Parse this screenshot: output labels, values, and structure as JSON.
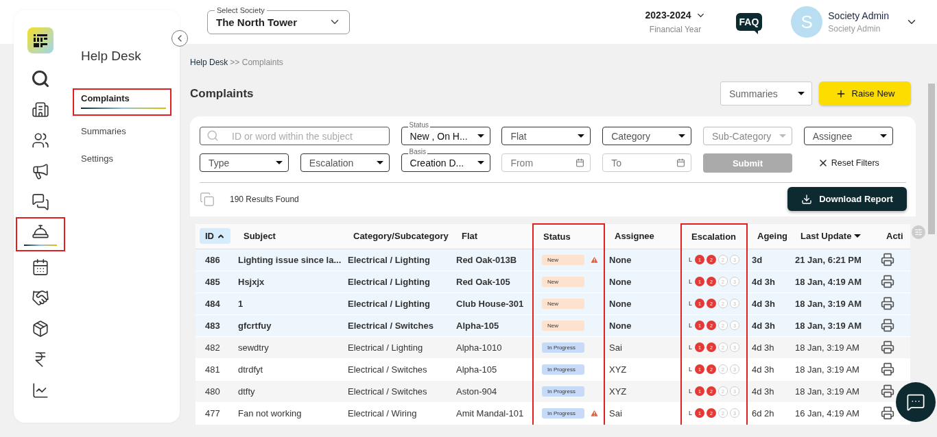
{
  "header": {
    "society": {
      "label": "Select Society",
      "value": "The North Tower"
    },
    "year": {
      "value": "2023-2024",
      "caption": "Financial Year"
    },
    "faq": "FAQ",
    "user": {
      "initial": "S",
      "name": "Society Admin",
      "role": "Society Admin"
    }
  },
  "rail": [
    {
      "selected": false,
      "highlighted": false
    },
    {
      "selected": false,
      "highlighted": false
    },
    {
      "selected": false,
      "highlighted": false
    },
    {
      "selected": false,
      "highlighted": false
    },
    {
      "selected": false,
      "highlighted": false
    },
    {
      "selected": true,
      "highlighted": true
    },
    {
      "selected": false,
      "highlighted": false
    },
    {
      "selected": false,
      "highlighted": false
    },
    {
      "selected": false,
      "highlighted": false
    },
    {
      "selected": false,
      "highlighted": false
    },
    {
      "selected": false,
      "highlighted": false
    }
  ],
  "submenu": {
    "title": "Help Desk",
    "items": [
      {
        "label": "Complaints",
        "selected": true,
        "highlighted": true
      },
      {
        "label": "Summaries",
        "selected": false,
        "highlighted": false
      },
      {
        "label": "Settings",
        "selected": false,
        "highlighted": false
      }
    ]
  },
  "breadcrumb": [
    "Help Desk",
    ">> Complaints"
  ],
  "page_title": "Complaints",
  "summaries_select": "Summaries",
  "raise_button": "Raise New",
  "filters": [
    {
      "kind": "search",
      "placeholder": "ID or word within the subject"
    },
    {
      "kind": "select",
      "label": "Status",
      "value": "New , On H...",
      "disabled": false
    },
    {
      "kind": "select",
      "placeholder": "Flat",
      "disabled": false
    },
    {
      "kind": "select",
      "placeholder": "Category",
      "disabled": false
    },
    {
      "kind": "select",
      "placeholder": "Sub-Category",
      "disabled": true
    },
    {
      "kind": "select",
      "placeholder": "Assignee",
      "disabled": false
    },
    {
      "kind": "select",
      "placeholder": "Type",
      "disabled": false
    },
    {
      "kind": "select",
      "placeholder": "Escalation",
      "disabled": false
    },
    {
      "kind": "select",
      "label": "Basis",
      "value": "Creation D...",
      "disabled": false
    },
    {
      "kind": "date",
      "placeholder": "From"
    },
    {
      "kind": "date",
      "placeholder": "To"
    },
    {
      "kind": "button",
      "label": "Submit",
      "disabled": true
    },
    {
      "kind": "link",
      "label": "Reset Filters"
    }
  ],
  "results": "190 Results Found",
  "download_button": "Download Report",
  "table": {
    "columns": [
      {
        "label": "ID",
        "sorted": true,
        "descending": false,
        "selected": true,
        "highlighted": false
      },
      {
        "label": "Subject",
        "sorted": false,
        "selected": false,
        "highlighted": false
      },
      {
        "label": "Category/Subcategory",
        "sorted": false,
        "selected": false,
        "highlighted": false
      },
      {
        "label": "Flat",
        "sorted": false,
        "selected": false,
        "highlighted": false
      },
      {
        "label": "Status",
        "sorted": false,
        "selected": false,
        "highlighted": true
      },
      {
        "label": "Assignee",
        "sorted": false,
        "selected": false,
        "highlighted": false
      },
      {
        "label": "Escalation",
        "sorted": false,
        "selected": false,
        "highlighted": true
      },
      {
        "label": "Ageing",
        "sorted": false,
        "selected": false,
        "highlighted": false
      },
      {
        "label": "Last Update",
        "sorted": true,
        "descending": true,
        "selected": false,
        "highlighted": false
      },
      {
        "label": "Acti",
        "sorted": false,
        "selected": false,
        "highlighted": false
      }
    ],
    "rows": [
      {
        "id": "486",
        "subject": "Lighting issue since la...",
        "category": "Electrical / Lighting",
        "flat": "Red Oak-013B",
        "status": {
          "label": "New",
          "kind": "new"
        },
        "warning": true,
        "assignee": "None",
        "escalation": {
          "prefix": "L",
          "levels": [
            {
              "label": "1",
              "reached": true
            },
            {
              "label": "2",
              "reached": true
            },
            {
              "label": "2",
              "reached": false
            },
            {
              "label": "3",
              "reached": false
            }
          ]
        },
        "ageing": "3d",
        "last_update": "21 Jan, 6:21 PM",
        "unread": true
      },
      {
        "id": "485",
        "subject": "Hsjxjx",
        "category": "Electrical / Lighting",
        "flat": "Red Oak-105",
        "status": {
          "label": "New",
          "kind": "new"
        },
        "warning": false,
        "assignee": "None",
        "escalation": {
          "prefix": "L",
          "levels": [
            {
              "label": "1",
              "reached": true
            },
            {
              "label": "2",
              "reached": true
            },
            {
              "label": "2",
              "reached": false
            },
            {
              "label": "3",
              "reached": false
            }
          ]
        },
        "ageing": "4d 3h",
        "last_update": "18 Jan, 4:19 AM",
        "unread": true
      },
      {
        "id": "484",
        "subject": "1",
        "category": "Electrical / Lighting",
        "flat": "Club House-301",
        "status": {
          "label": "New",
          "kind": "new"
        },
        "warning": false,
        "assignee": "None",
        "escalation": {
          "prefix": "L",
          "levels": [
            {
              "label": "1",
              "reached": true
            },
            {
              "label": "2",
              "reached": true
            },
            {
              "label": "2",
              "reached": false
            },
            {
              "label": "3",
              "reached": false
            }
          ]
        },
        "ageing": "4d 3h",
        "last_update": "18 Jan, 3:19 AM",
        "unread": true
      },
      {
        "id": "483",
        "subject": "gfcrtfuy",
        "category": "Electrical / Switches",
        "flat": "Alpha-105",
        "status": {
          "label": "New",
          "kind": "new"
        },
        "warning": false,
        "assignee": "None",
        "escalation": {
          "prefix": "L",
          "levels": [
            {
              "label": "1",
              "reached": true
            },
            {
              "label": "2",
              "reached": true
            },
            {
              "label": "2",
              "reached": false
            },
            {
              "label": "3",
              "reached": false
            }
          ]
        },
        "ageing": "4d 3h",
        "last_update": "18 Jan, 3:19 AM",
        "unread": true
      },
      {
        "id": "482",
        "subject": "sewdtry",
        "category": "Electrical / Lighting",
        "flat": "Alpha-1010",
        "status": {
          "label": "In Progress",
          "kind": "progress"
        },
        "warning": false,
        "assignee": "Sai",
        "escalation": {
          "prefix": "L",
          "levels": [
            {
              "label": "1",
              "reached": true
            },
            {
              "label": "2",
              "reached": true
            },
            {
              "label": "2",
              "reached": false
            },
            {
              "label": "3",
              "reached": false
            }
          ]
        },
        "ageing": "4d 3h",
        "last_update": "18 Jan, 3:19 AM",
        "unread": false
      },
      {
        "id": "481",
        "subject": "dtrdfyt",
        "category": "Electrical / Switches",
        "flat": "Alpha-105",
        "status": {
          "label": "In Progress",
          "kind": "progress"
        },
        "warning": false,
        "assignee": "XYZ",
        "escalation": {
          "prefix": "L",
          "levels": [
            {
              "label": "1",
              "reached": true
            },
            {
              "label": "2",
              "reached": true
            },
            {
              "label": "2",
              "reached": false
            },
            {
              "label": "3",
              "reached": false
            }
          ]
        },
        "ageing": "4d 3h",
        "last_update": "18 Jan, 3:19 AM",
        "unread": false
      },
      {
        "id": "480",
        "subject": "dtfty",
        "category": "Electrical / Switches",
        "flat": "Aston-904",
        "status": {
          "label": "In Progress",
          "kind": "progress"
        },
        "warning": false,
        "assignee": "XYZ",
        "escalation": {
          "prefix": "L",
          "levels": [
            {
              "label": "1",
              "reached": true
            },
            {
              "label": "2",
              "reached": true
            },
            {
              "label": "2",
              "reached": false
            },
            {
              "label": "3",
              "reached": false
            }
          ]
        },
        "ageing": "4d 3h",
        "last_update": "18 Jan, 3:19 AM",
        "unread": false
      },
      {
        "id": "477",
        "subject": "Fan not working",
        "category": "Electrical / Wiring",
        "flat": "Amit Mandal-101",
        "status": {
          "label": "In Progress",
          "kind": "progress"
        },
        "warning": true,
        "assignee": "Sai",
        "escalation": {
          "prefix": "L",
          "levels": [
            {
              "label": "1",
              "reached": true
            },
            {
              "label": "2",
              "reached": true
            },
            {
              "label": "2",
              "reached": false
            },
            {
              "label": "3",
              "reached": false
            }
          ]
        },
        "ageing": "6d 2h",
        "last_update": "16 Jan, 4:19 AM",
        "unread": false
      }
    ]
  }
}
